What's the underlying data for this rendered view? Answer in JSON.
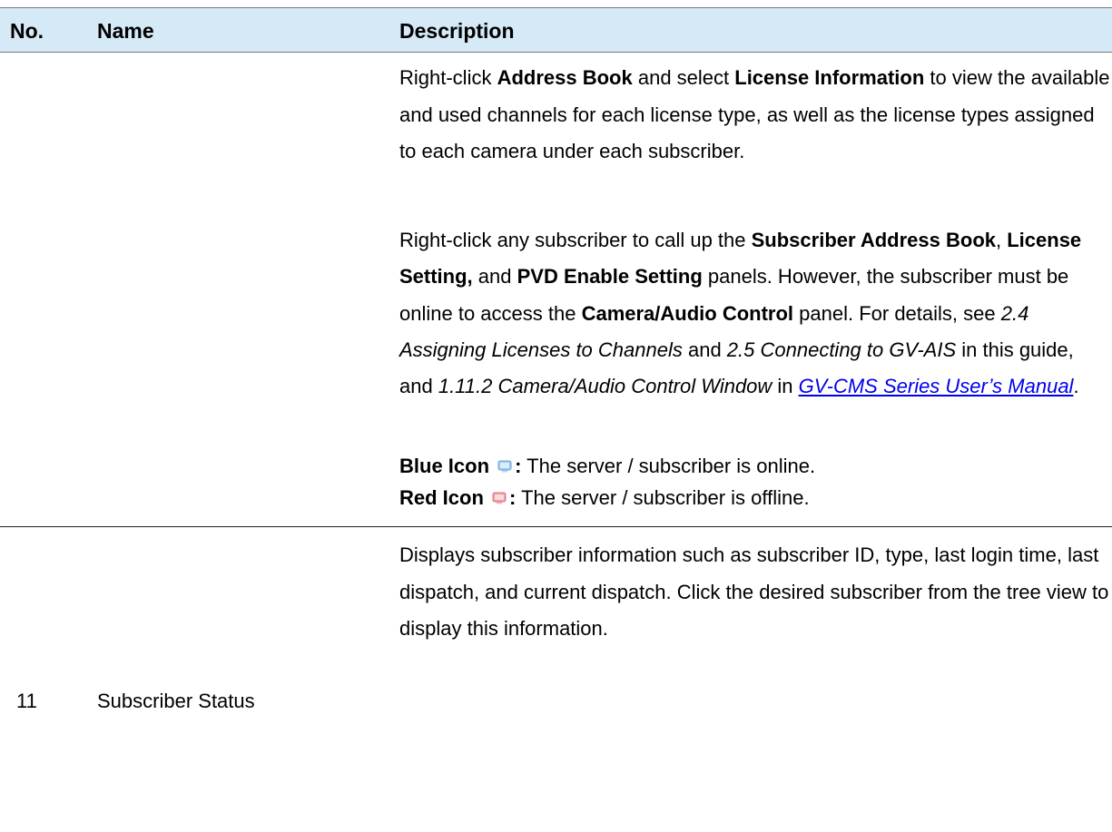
{
  "header": {
    "no": "No.",
    "name": "Name",
    "description": "Description"
  },
  "row10": {
    "para1": {
      "t1": "Right-click ",
      "b1": "Address Book",
      "t2": " and select ",
      "b2": "License Information",
      "t3": " to view the available and used channels for each license type, as well as the license types assigned to each camera under each subscriber."
    },
    "para2": {
      "t1": "Right-click any subscriber to call up the ",
      "b1": "Subscriber Address Book",
      "t2": ", ",
      "b2": "License Setting,",
      "t3": " and ",
      "b3": "PVD Enable Setting",
      "t4": " panels. However, the subscriber must be online to access the ",
      "b4": "Camera/Audio Control",
      "t5": " panel. For details, see ",
      "i1": "2.4 Assigning Licenses to Channels",
      "t6": " and ",
      "i2": "2.5 Connecting to GV-AIS",
      "t7": " in this guide, and ",
      "i3": "1.11.2 Camera/Audio Control Window",
      "t8": " in ",
      "link": "GV-CMS Series User’s Manual",
      "t9": "."
    },
    "blue_label": "Blue Icon",
    "blue_colon": ":",
    "blue_text": " The server / subscriber is online.",
    "red_label": "Red Icon",
    "red_colon": ":",
    "red_text": " The server / subscriber is offline.",
    "icons": {
      "blue": "blue-monitor-icon",
      "red": "red-monitor-icon",
      "blue_color": "#9ec9ec",
      "red_color": "#f0a0a8"
    }
  },
  "row11": {
    "no": "11",
    "name": "Subscriber Status",
    "description": "Displays subscriber information such as subscriber ID, type, last login time, last dispatch, and current dispatch. Click the desired subscriber from the tree view to display this information."
  },
  "colors": {
    "header_bg": "#d5e9f6",
    "link": "#0000ee"
  }
}
